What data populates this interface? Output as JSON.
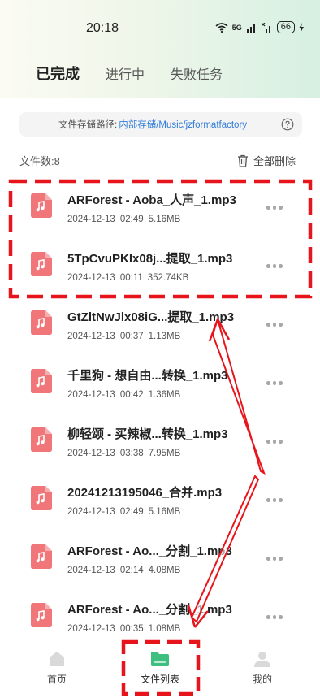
{
  "status_bar": {
    "time": "20:18",
    "network": "5G",
    "battery": "66"
  },
  "tabs": [
    {
      "label": "已完成",
      "active": true
    },
    {
      "label": "进行中",
      "active": false
    },
    {
      "label": "失败任务",
      "active": false
    }
  ],
  "path": {
    "label": "文件存储路径:",
    "value": "内部存储/Music/jzformatfactory"
  },
  "file_count": {
    "label": "文件数:",
    "value": "8"
  },
  "delete_all_label": "全部删除",
  "files": [
    {
      "name": "ARForest - Aoba_人声_1.mp3",
      "date": "2024-12-13",
      "time": "02:49",
      "size": "5.16MB"
    },
    {
      "name": "5TpCvuPKlx08j...提取_1.mp3",
      "date": "2024-12-13",
      "time": "00:11",
      "size": "352.74KB"
    },
    {
      "name": "GtZltNwJlx08iG...提取_1.mp3",
      "date": "2024-12-13",
      "time": "00:37",
      "size": "1.13MB"
    },
    {
      "name": "千里狗 - 想自由...转换_1.mp3",
      "date": "2024-12-13",
      "time": "00:42",
      "size": "1.36MB"
    },
    {
      "name": "柳轻颂 - 买辣椒...转换_1.mp3",
      "date": "2024-12-13",
      "time": "03:38",
      "size": "7.95MB"
    },
    {
      "name": "20241213195046_合并.mp3",
      "date": "2024-12-13",
      "time": "02:49",
      "size": "5.16MB"
    },
    {
      "name": "ARForest - Ao..._分割_1.mp3",
      "date": "2024-12-13",
      "time": "02:14",
      "size": "4.08MB"
    },
    {
      "name": "ARForest - Ao..._分割_1.mp3",
      "date": "2024-12-13",
      "time": "00:35",
      "size": "1.08MB"
    }
  ],
  "bottom_nav": [
    {
      "label": "首页",
      "icon": "home-icon",
      "active": false
    },
    {
      "label": "文件列表",
      "icon": "folder-icon",
      "active": true
    },
    {
      "label": "我的",
      "icon": "user-icon",
      "active": false
    }
  ],
  "colors": {
    "accent": "#3fbf7f",
    "link": "#2f7bd8",
    "file_icon": "#f0767a",
    "annotation": "#e8141b"
  }
}
